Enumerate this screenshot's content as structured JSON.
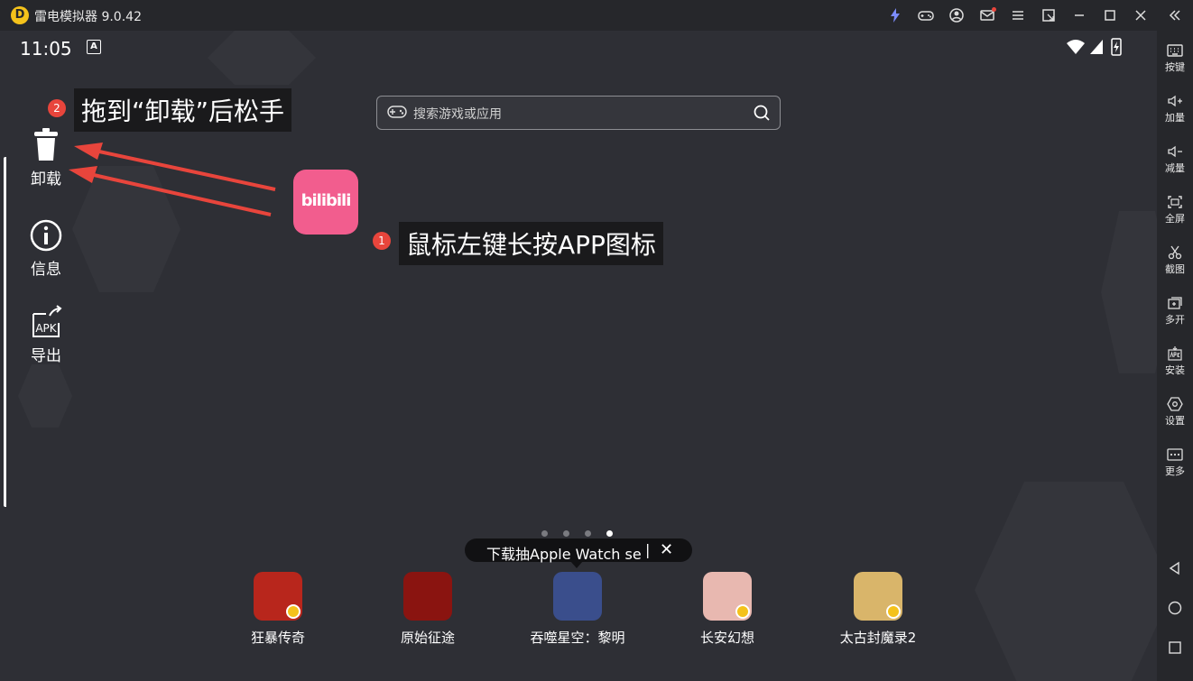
{
  "window": {
    "title": "雷电模拟器 9.0.42",
    "logo_letter": "D"
  },
  "status_bar": {
    "time": "11:05",
    "notification_letter": "A"
  },
  "drop_actions": [
    {
      "label": "卸载",
      "icon": "trash-icon"
    },
    {
      "label": "信息",
      "icon": "info-icon"
    },
    {
      "label": "导出",
      "icon": "apk-export-icon",
      "icon_text": "APK"
    }
  ],
  "search": {
    "placeholder": "搜索游戏或应用"
  },
  "bilibili": {
    "icon_text": "bilibili"
  },
  "tips": [
    {
      "number": "2",
      "text": "拖到“卸载”后松手"
    },
    {
      "number": "1",
      "text": "鼠标左键长按APP图标"
    }
  ],
  "pager": {
    "pages": 4,
    "active_index": 3
  },
  "promo": {
    "text": "下载抽Apple Watch se",
    "separator": "|",
    "close": "✕"
  },
  "dock": [
    {
      "label": "狂暴传奇",
      "color": "#b8261c"
    },
    {
      "label": "原始征途",
      "color": "#8a1410"
    },
    {
      "label": "吞噬星空：黎明",
      "color": "#3a4e8c"
    },
    {
      "label": "长安幻想",
      "color": "#e8b8b0"
    },
    {
      "label": "太古封魔录2",
      "color": "#d9b56a"
    }
  ],
  "sidebar": {
    "items": [
      {
        "label": "按键",
        "icon": "keyboard-icon"
      },
      {
        "label": "加量",
        "icon": "volume-up-icon"
      },
      {
        "label": "减量",
        "icon": "volume-down-icon"
      },
      {
        "label": "全屏",
        "icon": "fullscreen-icon"
      },
      {
        "label": "截图",
        "icon": "scissors-icon"
      },
      {
        "label": "多开",
        "icon": "multi-instance-icon"
      },
      {
        "label": "安装",
        "icon": "apk-install-icon"
      },
      {
        "label": "设置",
        "icon": "settings-icon"
      },
      {
        "label": "更多",
        "icon": "more-icon"
      }
    ]
  },
  "colors": {
    "accent": "#f4c21b",
    "badge_red": "#e8453c",
    "bilibili_pink": "#f25d8e"
  }
}
